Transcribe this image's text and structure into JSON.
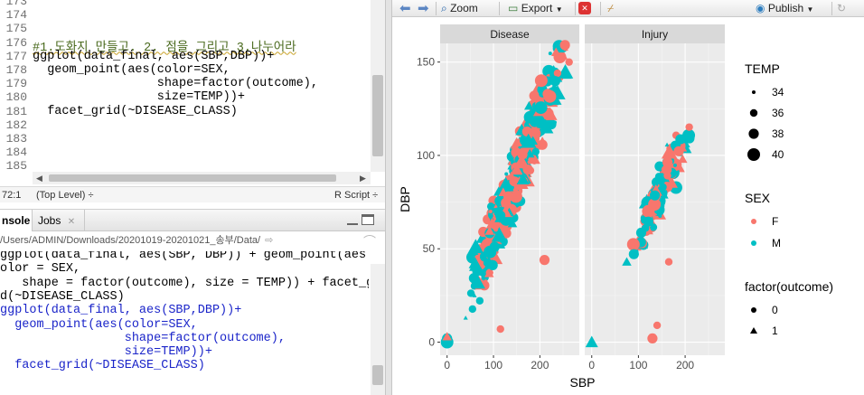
{
  "editor": {
    "line_numbers": [
      "173",
      "174",
      "175",
      "176",
      "177",
      "178",
      "179",
      "180",
      "181",
      "182",
      "183",
      "184",
      "185"
    ],
    "code_lines": [
      "",
      "",
      "",
      "#1.도화지 만들고. 2. 점을 그리고 3.나누어라",
      "ggplot(data_final, aes(SBP,DBP))+",
      "  geom_point(aes(color=SEX,",
      "                 shape=factor(outcome),",
      "                 size=TEMP))+",
      "  facet_grid(~DISEASE_CLASS)",
      "",
      "",
      "",
      ""
    ],
    "status": {
      "position": "72:1",
      "scope": "(Top Level) ÷",
      "filetype": "R Script ÷"
    }
  },
  "console": {
    "tabs": [
      "nsole",
      "Jobs"
    ],
    "path": "/Users/ADMIN/Downloads/20201019-20201021_송부/Data/",
    "output_lines": [
      "ggplot(data_final, aes(SBP, DBP)) + geom_point(aes",
      "olor = SEX,",
      "   shape = factor(outcome), size = TEMP)) + facet_g",
      "d(~DISEASE_CLASS)"
    ],
    "command_lines": [
      "ggplot(data_final, aes(SBP,DBP))+",
      "  geom_point(aes(color=SEX,",
      "                 shape=factor(outcome),",
      "                 size=TEMP))+",
      "  facet_grid(~DISEASE_CLASS)"
    ]
  },
  "plots_toolbar": {
    "zoom": "Zoom",
    "export": "Export",
    "publish": "Publish"
  },
  "chart_data": {
    "type": "scatter",
    "facets": [
      "Disease",
      "Injury"
    ],
    "xlabel": "SBP",
    "ylabel": "DBP",
    "x_ticks": [
      0,
      100,
      200
    ],
    "y_ticks": [
      0,
      50,
      100,
      150
    ],
    "xlim": [
      -15,
      285
    ],
    "ylim": [
      -7,
      160
    ],
    "colors": {
      "F": "#F8766D",
      "M": "#00BFC4",
      "panel": "#EBEBEB",
      "strip": "#D9D9D9"
    },
    "legends": {
      "size": {
        "title": "TEMP",
        "levels": [
          "34",
          "36",
          "38",
          "40"
        ]
      },
      "color": {
        "title": "SEX",
        "levels": [
          "F",
          "M"
        ]
      },
      "shape": {
        "title": "factor(outcome)",
        "levels": [
          "0",
          "1"
        ]
      }
    },
    "clusters": [
      {
        "facet": "Disease",
        "description": "dense diagonal cloud",
        "x_range": [
          45,
          265
        ],
        "dbp_at_x": [
          [
            50,
            25
          ],
          [
            150,
            90
          ],
          [
            250,
            150
          ]
        ],
        "spread": 25
      },
      {
        "facet": "Injury",
        "description": "smaller cloud",
        "x_range": [
          75,
          225
        ],
        "dbp_at_x": [
          [
            80,
            45
          ],
          [
            150,
            85
          ],
          [
            220,
            115
          ]
        ],
        "spread": 18
      }
    ],
    "outliers": [
      {
        "facet": "Disease",
        "x": 0,
        "y": 0,
        "sex": "M",
        "outcome": "0",
        "temp": 40
      },
      {
        "facet": "Disease",
        "x": 0,
        "y": 2,
        "sex": "M",
        "outcome": "0",
        "temp": 38
      },
      {
        "facet": "Disease",
        "x": 0,
        "y": 3,
        "sex": "F",
        "outcome": "1",
        "temp": 36
      },
      {
        "facet": "Disease",
        "x": 40,
        "y": 13,
        "sex": "M",
        "outcome": "1",
        "temp": 34
      },
      {
        "facet": "Disease",
        "x": 115,
        "y": 7,
        "sex": "F",
        "outcome": "0",
        "temp": 36
      },
      {
        "facet": "Disease",
        "x": 210,
        "y": 44,
        "sex": "F",
        "outcome": "0",
        "temp": 38
      },
      {
        "facet": "Disease",
        "x": 263,
        "y": 150,
        "sex": "F",
        "outcome": "0",
        "temp": 36
      },
      {
        "facet": "Injury",
        "x": 0,
        "y": 0,
        "sex": "M",
        "outcome": "1",
        "temp": 38
      },
      {
        "facet": "Injury",
        "x": 130,
        "y": 2,
        "sex": "F",
        "outcome": "0",
        "temp": 38
      },
      {
        "facet": "Injury",
        "x": 140,
        "y": 9,
        "sex": "F",
        "outcome": "0",
        "temp": 36
      },
      {
        "facet": "Injury",
        "x": 165,
        "y": 43,
        "sex": "F",
        "outcome": "0",
        "temp": 36
      },
      {
        "facet": "Injury",
        "x": 75,
        "y": 43,
        "sex": "M",
        "outcome": "1",
        "temp": 36
      }
    ]
  }
}
